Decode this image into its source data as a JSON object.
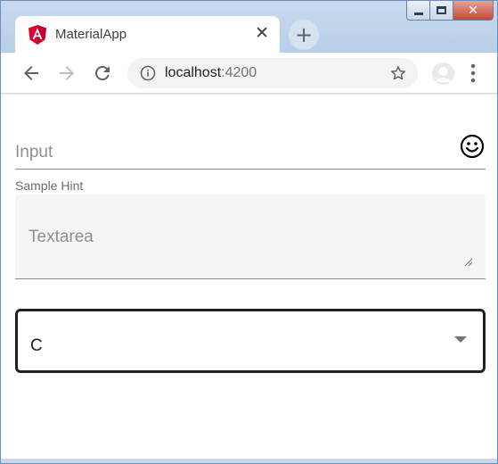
{
  "browser": {
    "tab": {
      "title": "MaterialApp",
      "close_glyph": "✕"
    },
    "new_tab_glyph": "+",
    "address": {
      "host": "localhost",
      "port": ":4200"
    },
    "icons": {
      "favicon": "angular-icon",
      "back": "back-arrow-icon",
      "forward": "forward-arrow-icon",
      "reload": "reload-icon",
      "info": "info-icon",
      "bookmark": "star-icon",
      "profile": "profile-icon",
      "menu": "kebab-menu-icon"
    },
    "window_controls": {
      "close_glyph": "✕"
    }
  },
  "form": {
    "input": {
      "placeholder": "Input",
      "suffix_icon": "smiley-icon"
    },
    "hint": "Sample Hint",
    "textarea": {
      "placeholder": "Textarea"
    },
    "select": {
      "value": "C"
    }
  },
  "colors": {
    "angular_red": "#dd0031",
    "border": "#212121",
    "placeholder": "#8f8f8f",
    "textarea_fill": "#f5f5f5"
  }
}
